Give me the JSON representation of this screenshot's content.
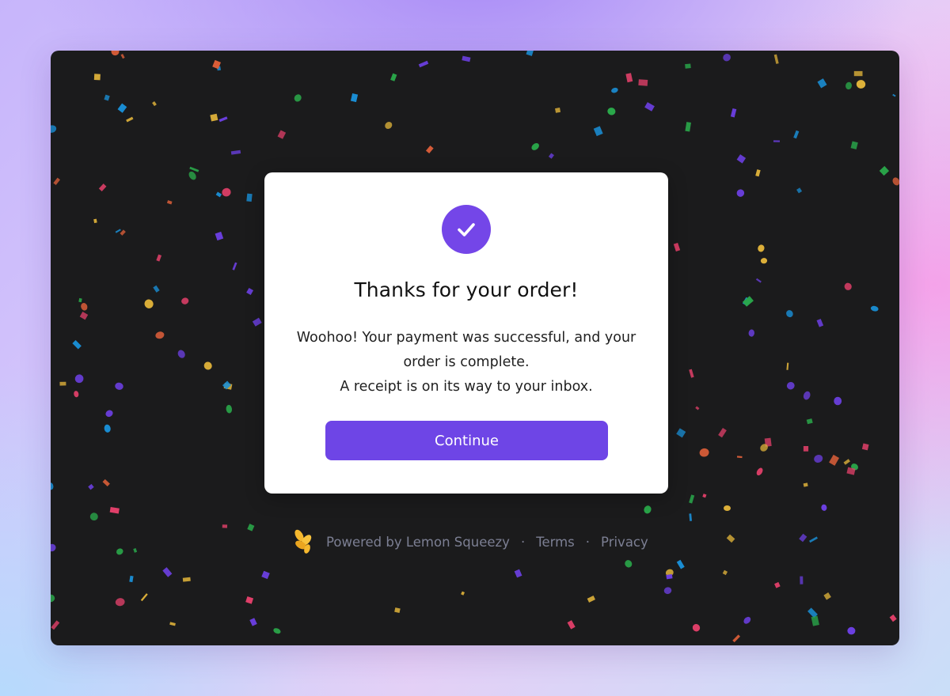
{
  "modal": {
    "title": "Thanks for your order!",
    "message_lines": [
      "Woohoo! Your payment was successful, and your",
      "order is complete.",
      "A receipt is on its way to your inbox."
    ],
    "continue_label": "Continue",
    "icon": "check-icon"
  },
  "footer": {
    "powered_by": "Powered by Lemon Squeezy",
    "separator": "·",
    "terms": "Terms",
    "privacy": "Privacy",
    "logo_icon": "lemon-squeezy-logo"
  },
  "colors": {
    "accent": "#6e45e6",
    "window_bg": "#1b1b1c",
    "footer_text": "#7c7f93",
    "confetti": [
      "#e0b33a",
      "#2aa84a",
      "#1a8fd6",
      "#e0603a",
      "#e3406a",
      "#6b3fe0"
    ]
  }
}
